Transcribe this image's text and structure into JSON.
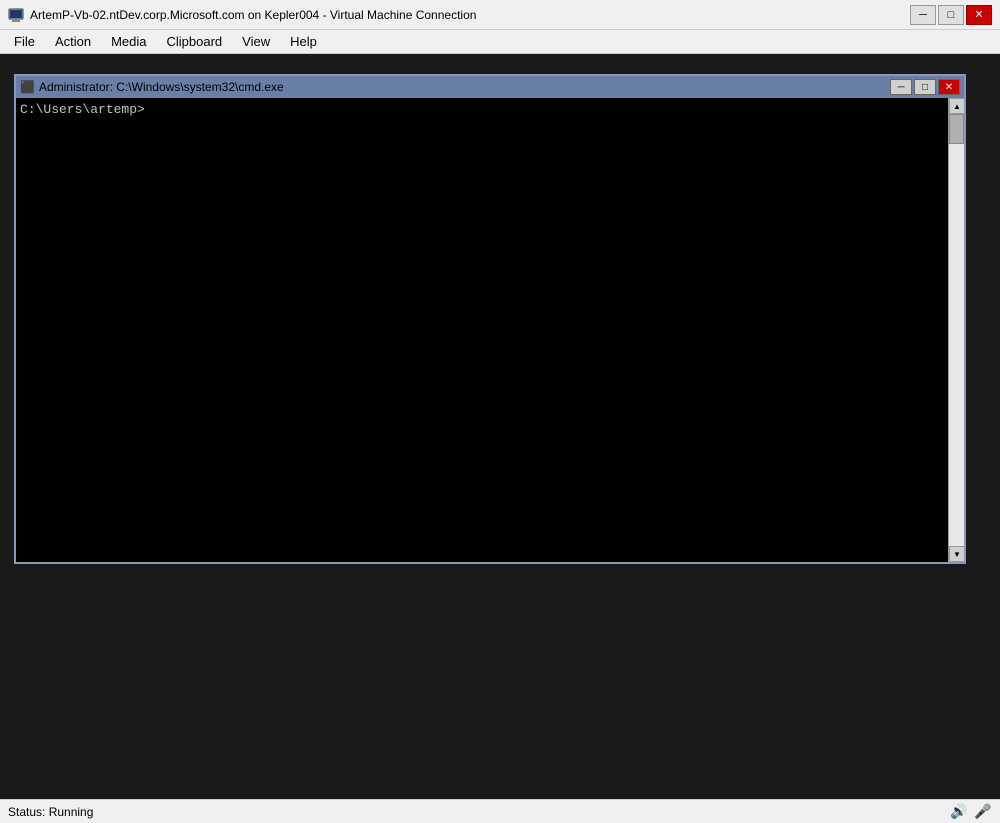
{
  "window": {
    "title": "ArtemP-Vb-02.ntDev.corp.Microsoft.com on Kepler004 - Virtual Machine Connection",
    "icon": "vm-icon"
  },
  "title_bar_controls": {
    "minimize_label": "─",
    "maximize_label": "□",
    "close_label": "✕"
  },
  "menu_bar": {
    "items": [
      {
        "label": "File"
      },
      {
        "label": "Action"
      },
      {
        "label": "Media"
      },
      {
        "label": "Clipboard"
      },
      {
        "label": "View"
      },
      {
        "label": "Help"
      }
    ]
  },
  "cmd_window": {
    "title": "Administrator: C:\\Windows\\system32\\cmd.exe",
    "icon": "cmd-icon",
    "controls": {
      "minimize_label": "─",
      "maximize_label": "□",
      "close_label": "✕"
    },
    "prompt": "C:\\Users\\artemp>"
  },
  "status_bar": {
    "status_label": "Status:",
    "status_value": "Running"
  },
  "scrollbar": {
    "arrow_up": "▲",
    "arrow_down": "▼"
  }
}
